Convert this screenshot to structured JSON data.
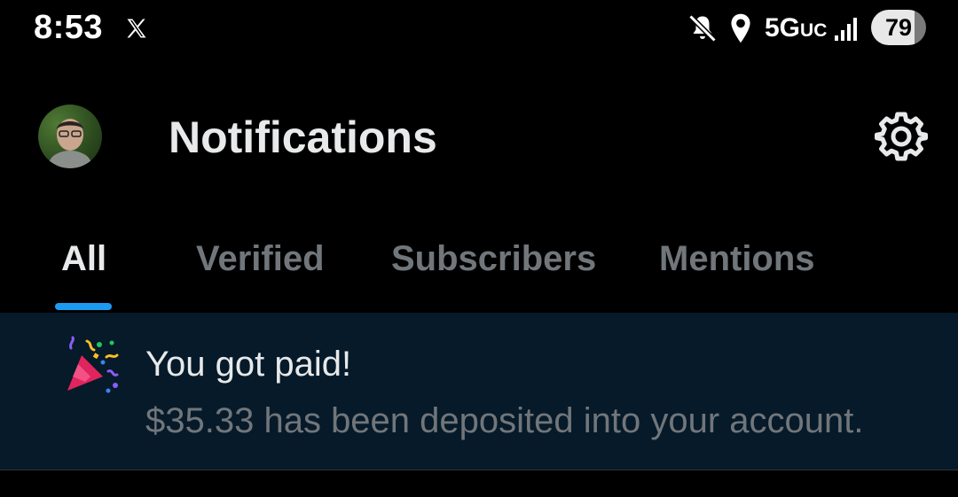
{
  "status_bar": {
    "time": "8:53",
    "network_main": "5G",
    "network_sub": "UC",
    "battery_level": "79",
    "icons": [
      "x-logo-icon",
      "mute-icon",
      "location-icon",
      "signal-icon",
      "battery-icon"
    ]
  },
  "header": {
    "title": "Notifications",
    "avatar_icon": "avatar",
    "settings_icon": "gear-icon"
  },
  "tabs": [
    {
      "label": "All",
      "active": true
    },
    {
      "label": "Verified",
      "active": false
    },
    {
      "label": "Subscribers",
      "active": false
    },
    {
      "label": "Mentions",
      "active": false
    }
  ],
  "notifications": [
    {
      "icon": "party-popper-icon",
      "title": "You got paid!",
      "body": "$35.33 has been deposited into your account."
    }
  ],
  "colors": {
    "background": "#000000",
    "accent": "#1d9bf0",
    "text_primary": "#e7e9ea",
    "text_secondary": "#71767b",
    "notification_bg": "#061a29"
  }
}
